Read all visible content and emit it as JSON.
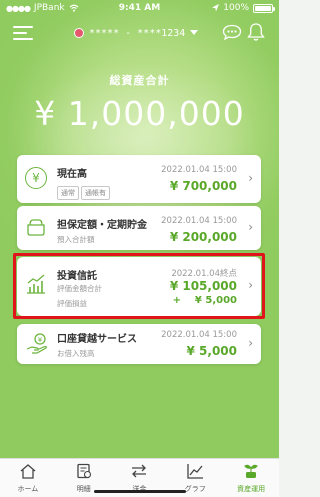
{
  "status_bar": {
    "carrier": "JPBank",
    "time": "9:41 AM",
    "battery": "100%"
  },
  "header": {
    "account": "***** - ****1234"
  },
  "summary": {
    "label": "総資産合計",
    "amount": "¥ 1,000,000"
  },
  "cards": [
    {
      "title": "現在高",
      "date": "2022.01.04 15:00",
      "amount": "¥ 700,000",
      "tags": [
        "通常",
        "通帳有"
      ],
      "icon": "yen-icon"
    },
    {
      "title": "担保定額・定期貯金",
      "date": "2022.01.04 15:00",
      "amount": "¥ 200,000",
      "sub_label": "預入合計額",
      "icon": "bag-icon"
    },
    {
      "title": "投資信託",
      "date": "2022.01.04終点",
      "amount": "¥ 105,000",
      "amount_label": "評価金額合計",
      "gain_label": "評価損益",
      "gain_sign": "+",
      "gain": "¥ 5,000",
      "icon": "chart-icon"
    },
    {
      "title": "口座貸越サービス",
      "date": "2022.01.04 15:00",
      "amount": "¥ 5,000",
      "sub_label": "お借入残高",
      "icon": "hand-coin-icon"
    }
  ],
  "tabs": [
    {
      "label": "ホーム",
      "icon": "home-icon"
    },
    {
      "label": "明細",
      "icon": "statement-icon"
    },
    {
      "label": "送金",
      "icon": "transfer-icon"
    },
    {
      "label": "グラフ",
      "icon": "graph-icon"
    },
    {
      "label": "資産運用",
      "icon": "asset-icon",
      "active": true
    }
  ],
  "colors": {
    "accent": "#5aa82a",
    "highlight": "#e0151b"
  }
}
